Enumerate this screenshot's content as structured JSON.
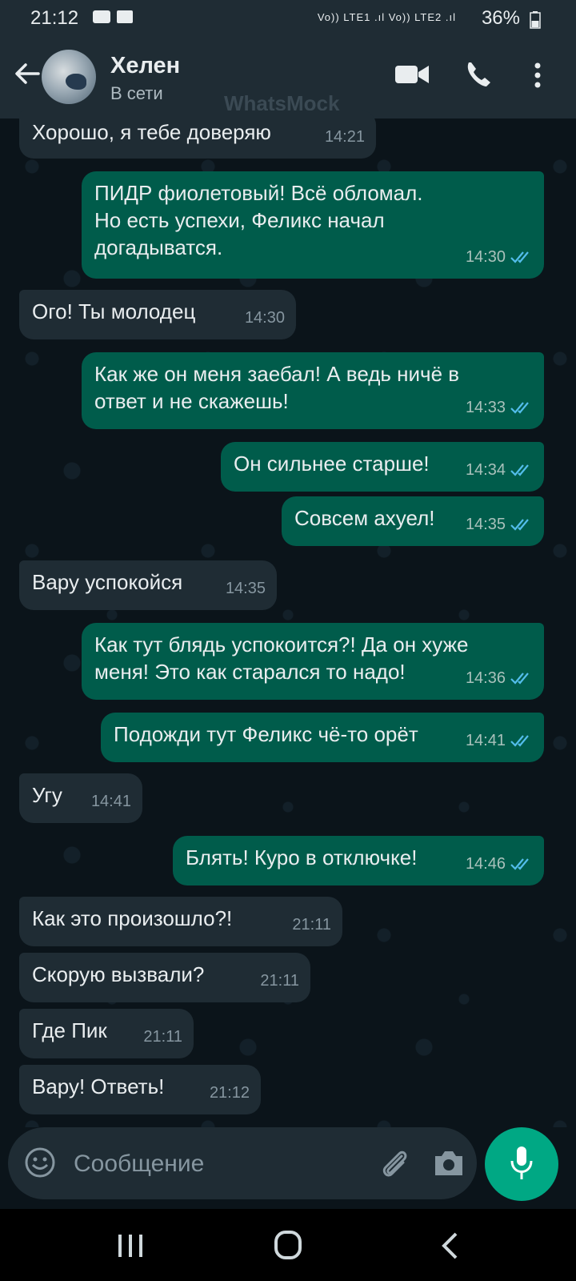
{
  "status_bar": {
    "time": "21:12",
    "signal_text": "Vo)) LTE1 .ıl Vo)) LTE2 .ıl",
    "battery_percent": "36%"
  },
  "header": {
    "contact_name": "Хелен",
    "contact_status": "В сети",
    "watermark": "WhatsMock",
    "icons": [
      "back-arrow-icon",
      "video-call-icon",
      "voice-call-icon",
      "more-options-icon"
    ]
  },
  "messages": [
    {
      "dir": "in",
      "text": "Хорошо, я тебе доверяю",
      "time": "14:21"
    },
    {
      "dir": "out",
      "text": "ПИДР фиолетовый! Всё обломал.\nНо есть успехи, Феликс начал\nдогадыватся.",
      "time": "14:30",
      "status": "read"
    },
    {
      "dir": "in",
      "text": "Ого! Ты молодец",
      "time": "14:30"
    },
    {
      "dir": "out",
      "text": "Как же он меня заебал! А ведь ничё в\nответ и не скажешь!",
      "time": "14:33",
      "status": "read"
    },
    {
      "dir": "out",
      "text": "Он сильнее старше!",
      "time": "14:34",
      "status": "read"
    },
    {
      "dir": "out",
      "text": "Совсем ахуел!",
      "time": "14:35",
      "status": "read"
    },
    {
      "dir": "in",
      "text": "Вару успокойся",
      "time": "14:35"
    },
    {
      "dir": "out",
      "text": "Как тут блядь успокоится?! Да он хуже\nменя! Это как старался то надо!",
      "time": "14:36",
      "status": "read"
    },
    {
      "dir": "out",
      "text": "Подожди тут Феликс чё-то орёт",
      "time": "14:41",
      "status": "read"
    },
    {
      "dir": "in",
      "text": "Угу",
      "time": "14:41"
    },
    {
      "dir": "out",
      "text": "Блять! Куро в отключке!",
      "time": "14:46",
      "status": "read"
    },
    {
      "dir": "in",
      "text": "Как это произошло?!",
      "time": "21:11"
    },
    {
      "dir": "in",
      "text": "Скорую вызвали?",
      "time": "21:11"
    },
    {
      "dir": "in",
      "text": "Где Пик",
      "time": "21:11"
    },
    {
      "dir": "in",
      "text": "Вару! Ответь!",
      "time": "21:12"
    }
  ],
  "composer": {
    "placeholder": "Сообщение",
    "icons": [
      "emoji-icon",
      "attach-icon",
      "camera-icon",
      "mic-icon"
    ]
  },
  "colors": {
    "background": "#0b141a",
    "header": "#1f2c34",
    "incoming_bubble": "#1f2c34",
    "outgoing_bubble": "#005c4b",
    "accent": "#00a884",
    "read_ticks": "#53bdeb"
  }
}
